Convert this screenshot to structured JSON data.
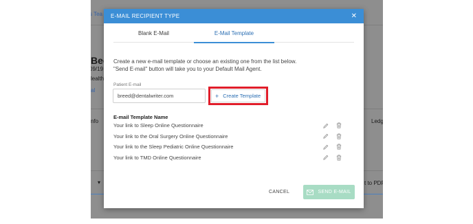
{
  "background": {
    "frag_top": "s Tea",
    "frag_name": "Bec",
    "frag_date": "09/19",
    "frag_health": "lealth",
    "frag_al": "al",
    "frag_info": "nfo",
    "frag_ledg": "Ledg",
    "frag_pdf": "t to PDF"
  },
  "modal": {
    "title": "E-MAIL RECIPIENT TYPE",
    "tabs": [
      {
        "label": "Blank E-Mail"
      },
      {
        "label": "E-Mail Template"
      }
    ],
    "active_tab": "E-Mail Template",
    "intro_line1": "Create a new e-mail template or choose an existing one from the list below.",
    "intro_line2": "\"Send E-mail\" button will take you to your Default Mail Agent.",
    "email_label": "Patient E-mail",
    "email_value": "breed@dentalwriter.com",
    "create_label": "Create Template",
    "list_title": "E-mail Template Name",
    "templates": [
      {
        "name": "Your link to Sleep Online Questionnaire"
      },
      {
        "name": "Your link to the Oral Surgery Online Questionnaire"
      },
      {
        "name": "Your link to the Sleep Pediatric Online Questionnaire"
      },
      {
        "name": "Your link to TMD Online Questionnaire"
      }
    ],
    "cancel_label": "CANCEL",
    "send_label": "SEND E-MAIL"
  },
  "colors": {
    "header": "#3b8ed6",
    "highlight": "#e11d2a",
    "send_disabled": "#a8dcc4"
  }
}
